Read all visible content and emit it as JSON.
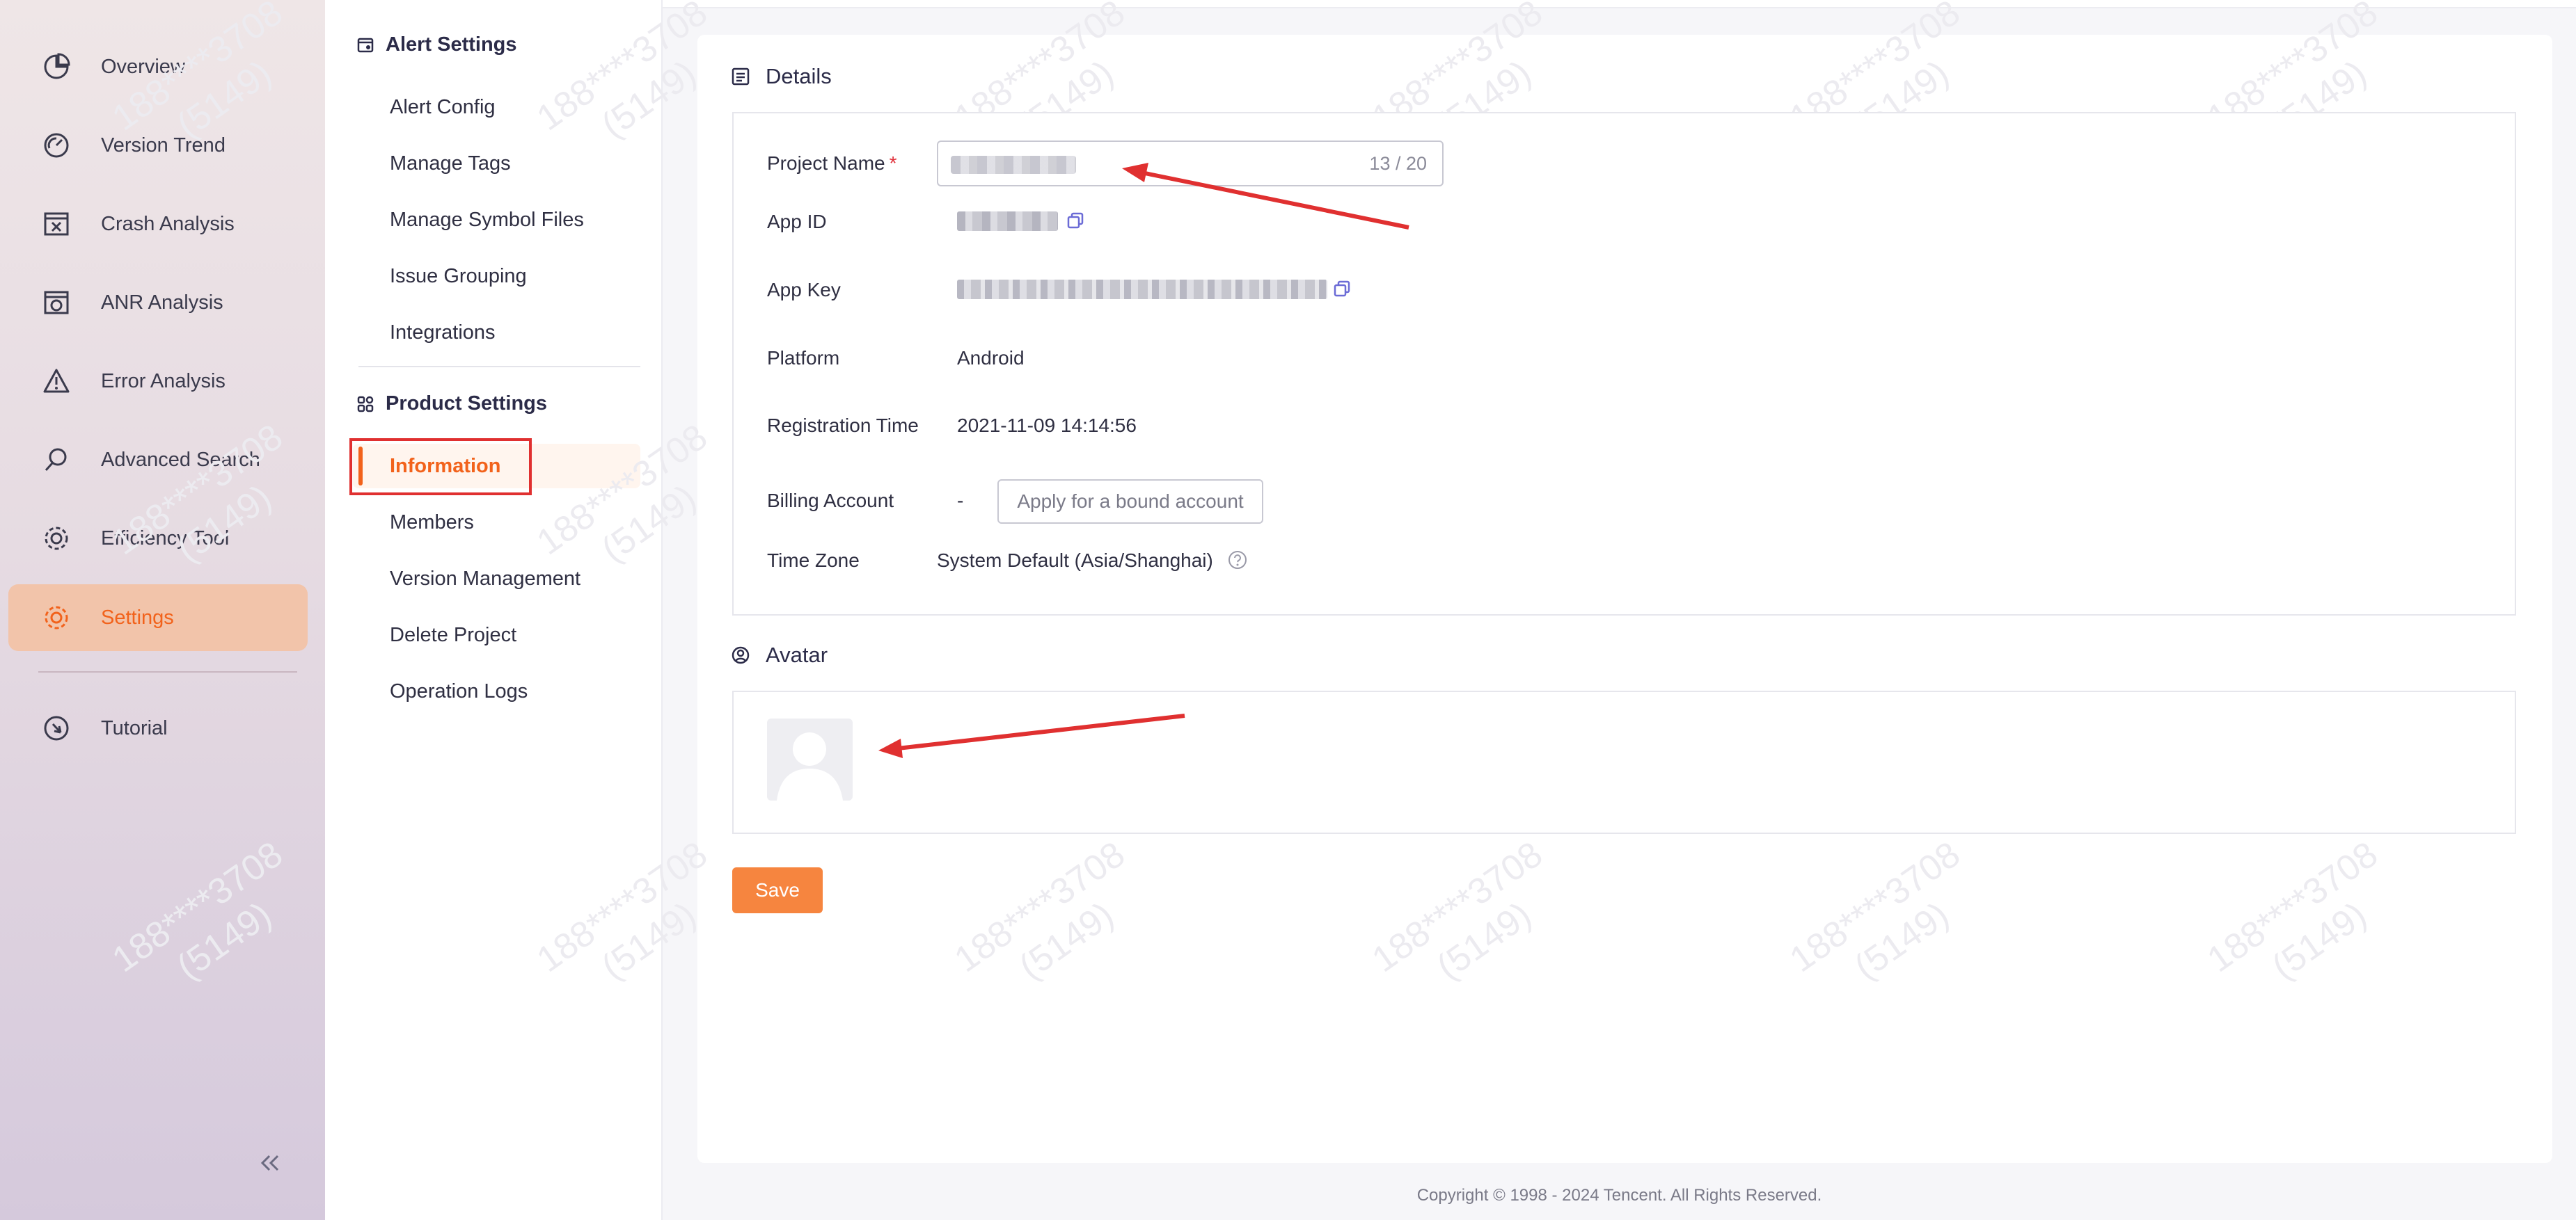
{
  "sidebar": {
    "items": [
      {
        "label": "Overview",
        "icon": "pie-chart-icon"
      },
      {
        "label": "Version Trend",
        "icon": "gauge-icon"
      },
      {
        "label": "Crash Analysis",
        "icon": "crash-window-icon"
      },
      {
        "label": "ANR Analysis",
        "icon": "anr-window-icon"
      },
      {
        "label": "Error Analysis",
        "icon": "warning-triangle-icon"
      },
      {
        "label": "Advanced Search",
        "icon": "search-icon"
      },
      {
        "label": "Efficiency Tool",
        "icon": "gear-icon"
      },
      {
        "label": "Settings",
        "icon": "settings-gear-icon"
      },
      {
        "label": "Tutorial",
        "icon": "compass-icon"
      }
    ],
    "active": "Settings",
    "collapse_icon": "double-chevron-left-icon"
  },
  "submenu": {
    "alert_group": {
      "title": "Alert Settings",
      "items": [
        "Alert Config",
        "Manage Tags",
        "Manage Symbol Files",
        "Issue Grouping",
        "Integrations"
      ]
    },
    "product_group": {
      "title": "Product Settings",
      "items": [
        "Information",
        "Members",
        "Version Management",
        "Delete Project",
        "Operation Logs"
      ]
    },
    "active": "Information"
  },
  "details": {
    "title": "Details",
    "project_name_label": "Project Name",
    "required_mark": "*",
    "project_name_counter": "13 / 20",
    "app_id_label": "App ID",
    "app_key_label": "App Key",
    "platform_label": "Platform",
    "platform_value": "Android",
    "registration_label": "Registration Time",
    "registration_value": "2021-11-09 14:14:56",
    "billing_label": "Billing Account",
    "billing_value": "-",
    "billing_button": "Apply for a bound account",
    "timezone_label": "Time Zone",
    "timezone_value": "System Default (Asia/Shanghai)"
  },
  "avatar": {
    "title": "Avatar"
  },
  "save_label": "Save",
  "footer": {
    "copyright": "Copyright © 1998 - 2024 Tencent. All Rights Reserved."
  },
  "watermark": {
    "line1": "188****3708",
    "line2": "(5149)"
  },
  "colors": {
    "accent": "#f2621b",
    "save_button": "#f6853f",
    "annotation_red": "#e03030"
  }
}
